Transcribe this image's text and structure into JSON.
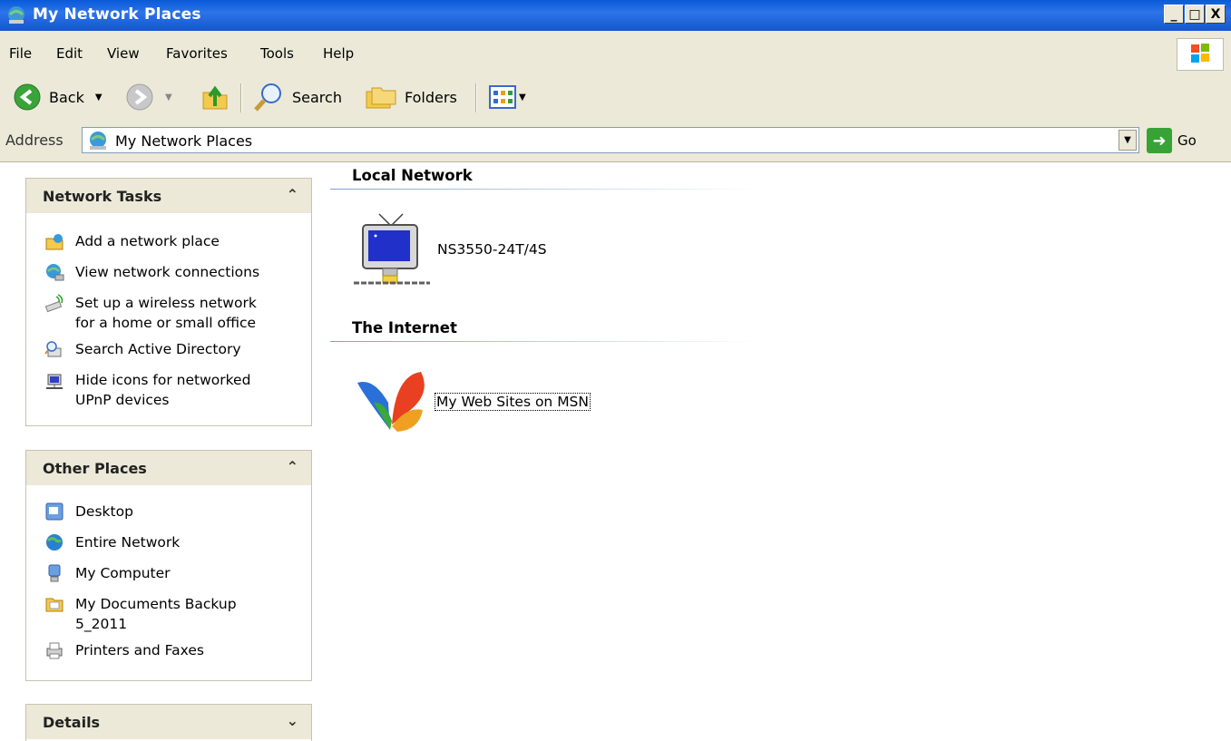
{
  "window": {
    "title": "My Network Places",
    "minimize": "_",
    "maximize": "□",
    "close": "X"
  },
  "menu": [
    "File",
    "Edit",
    "View",
    "Favorites",
    "Tools",
    "Help"
  ],
  "toolbar": {
    "back": "Back",
    "search": "Search",
    "folders": "Folders"
  },
  "address": {
    "label": "Address",
    "value": "My Network Places",
    "go": "Go"
  },
  "network_tasks": {
    "title": "Network Tasks",
    "items": [
      {
        "label": "Add a network place",
        "icon": "add-network-place-icon"
      },
      {
        "label": "View network connections",
        "icon": "network-connections-icon"
      },
      {
        "label": "Set up a wireless network",
        "label2": "for a home or small office",
        "icon": "wireless-icon"
      },
      {
        "label": "Search Active Directory",
        "icon": "search-directory-icon"
      },
      {
        "label": "Hide icons for networked",
        "label2": "UPnP devices",
        "icon": "upnp-device-icon"
      }
    ]
  },
  "other_places": {
    "title": "Other Places",
    "items": [
      {
        "label": "Desktop",
        "icon": "desktop-icon"
      },
      {
        "label": "Entire Network",
        "icon": "globe-icon"
      },
      {
        "label": "My Computer",
        "icon": "computer-icon"
      },
      {
        "label": "My Documents Backup",
        "label2": "5_2011",
        "icon": "folder-icon"
      },
      {
        "label": "Printers and Faxes",
        "icon": "printer-icon"
      }
    ]
  },
  "details": {
    "title": "Details"
  },
  "content": {
    "local_network": {
      "title": "Local Network",
      "items": [
        {
          "label": "NS3550-24T/4S"
        }
      ]
    },
    "internet": {
      "title": "The Internet",
      "items": [
        {
          "label": "My Web Sites on MSN"
        }
      ]
    }
  }
}
